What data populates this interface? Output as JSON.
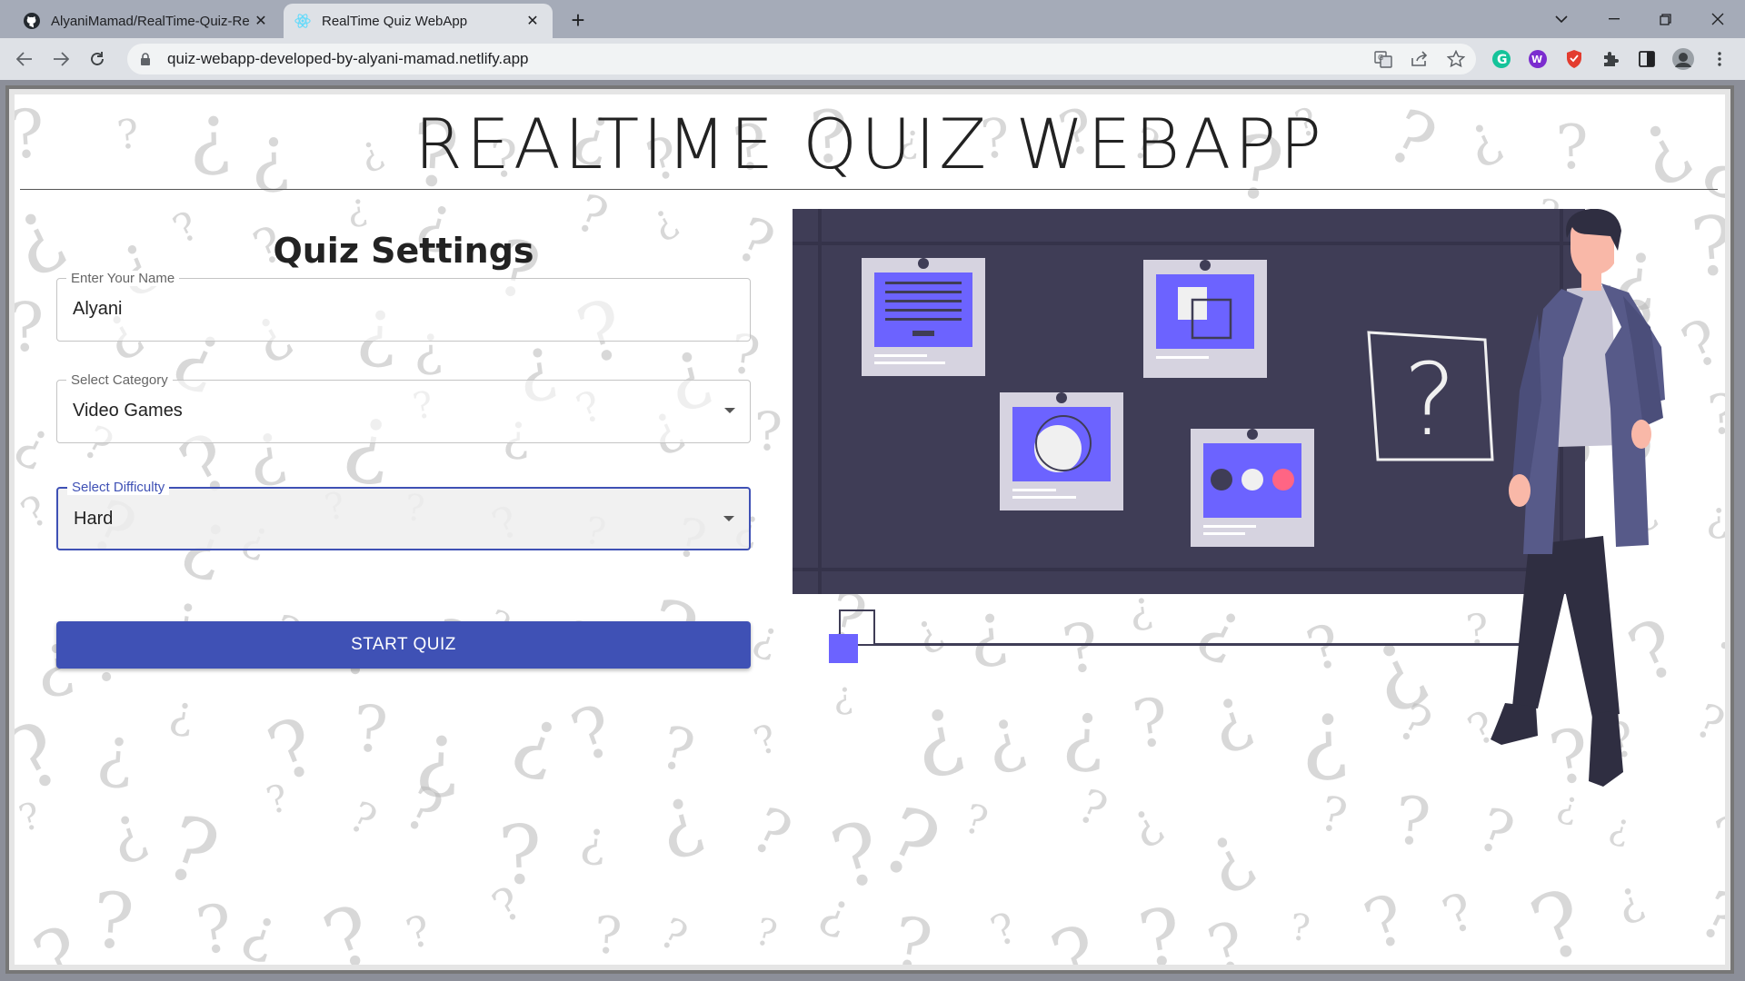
{
  "browser": {
    "tabs": [
      {
        "title": "AlyaniMamad/RealTime-Quiz-Re",
        "icon": "github-icon",
        "active": false
      },
      {
        "title": "RealTime Quiz WebApp",
        "icon": "react-icon",
        "active": true
      }
    ],
    "url": "quiz-webapp-developed-by-alyani-mamad.netlify.app"
  },
  "app": {
    "title": "REALTIME QUIZ WEBAPP",
    "settings_heading": "Quiz Settings",
    "name_field": {
      "label": "Enter Your Name",
      "value": "Alyani"
    },
    "category_field": {
      "label": "Select Category",
      "value": "Video Games"
    },
    "difficulty_field": {
      "label": "Select Difficulty",
      "value": "Hard"
    },
    "start_button": "START QUIZ"
  },
  "colors": {
    "primary": "#3f51b5",
    "board": "#3f3d56",
    "card_accent": "#6c63ff",
    "pink_dot": "#ff6584"
  }
}
